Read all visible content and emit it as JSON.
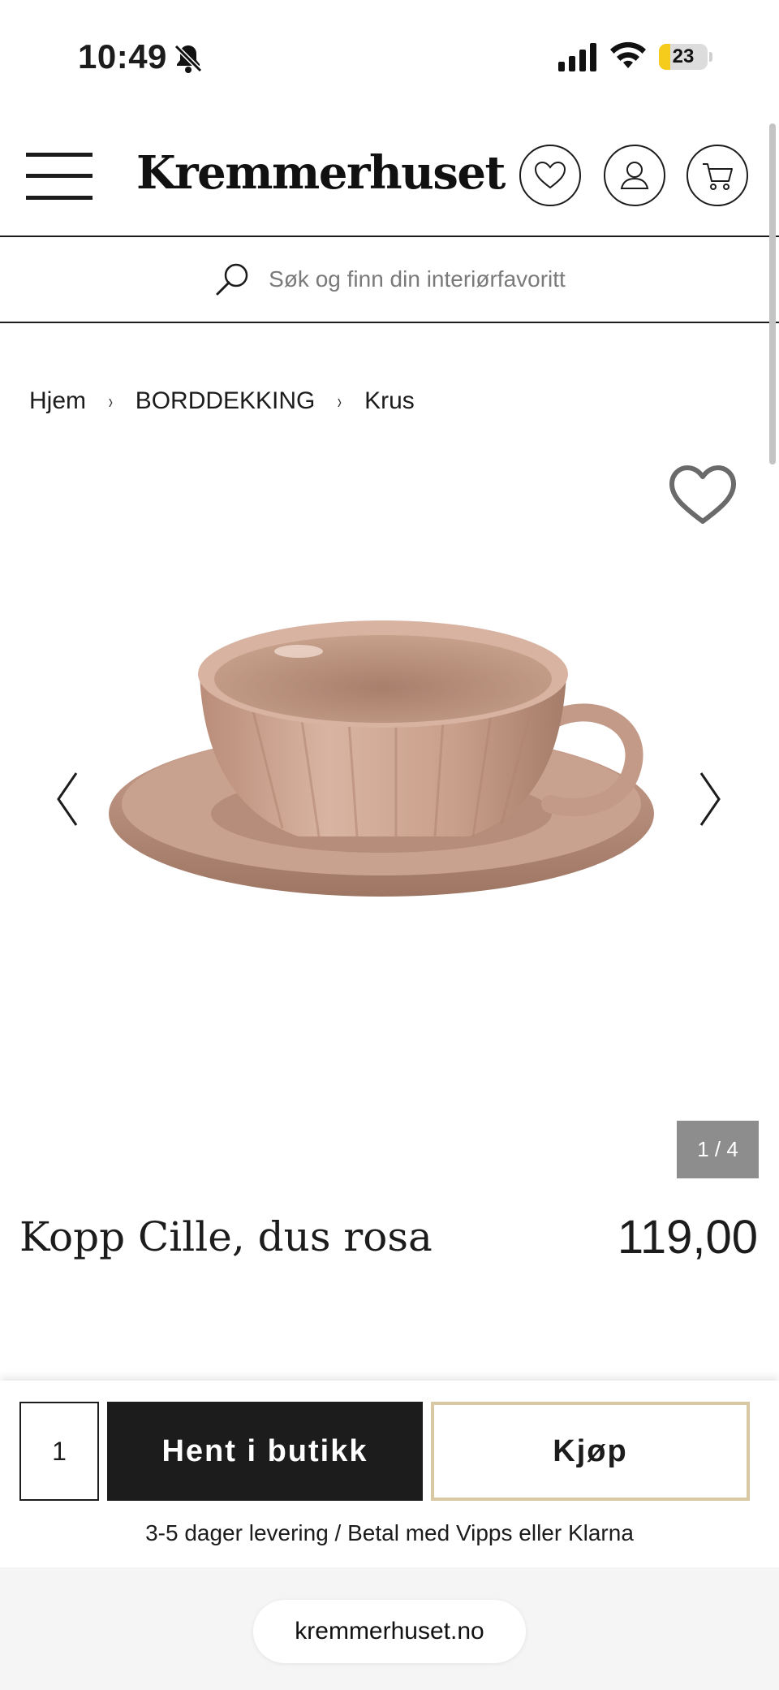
{
  "status_bar": {
    "time": "10:49",
    "battery_level": "23",
    "battery_fraction": 0.23,
    "battery_color": "#f5cb1c",
    "icons": [
      "bell-slash-icon",
      "signal-icon",
      "wifi-icon",
      "battery-charging-icon"
    ]
  },
  "header": {
    "logo": "Kremmerhuset",
    "icons": [
      "menu-icon",
      "heart-icon",
      "user-icon",
      "cart-icon"
    ]
  },
  "search": {
    "placeholder": "Søk og finn din interiørfavoritt"
  },
  "breadcrumb": {
    "items": [
      "Hjem",
      "BORDDEKKING",
      "Krus"
    ],
    "separator": "›"
  },
  "gallery": {
    "counter": "1 / 4",
    "current": 1,
    "total": 4,
    "product_color": "#c9a08e"
  },
  "product": {
    "title": "Kopp Cille, dus rosa",
    "price": "119,00"
  },
  "purchase": {
    "quantity": "1",
    "store_pickup_label": "Hent i butikk",
    "buy_label": "Kjøp",
    "delivery_info": "3-5 dager levering / Betal med Vipps eller Klarna",
    "accent_color": "#d8c8a4"
  },
  "browser": {
    "url": "kremmerhuset.no"
  }
}
